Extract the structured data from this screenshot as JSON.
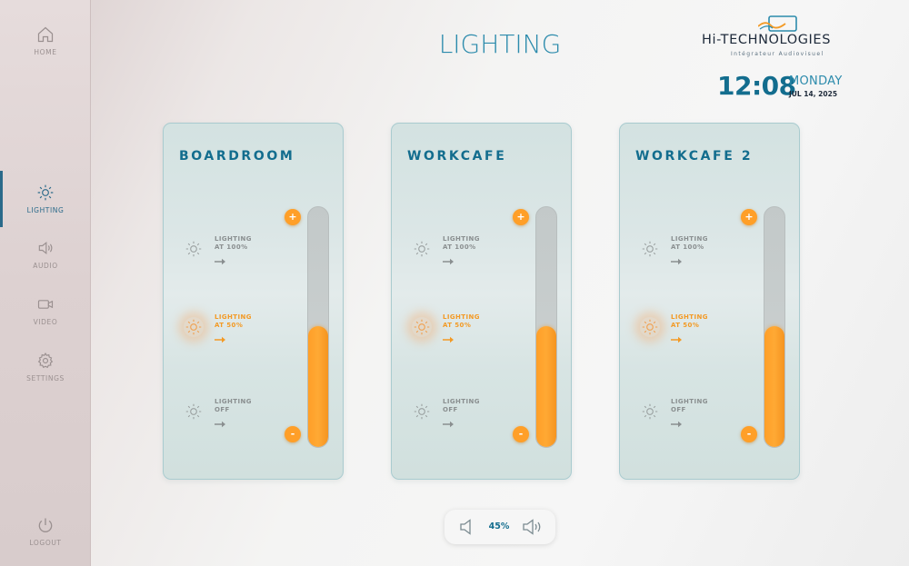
{
  "nav": {
    "items": [
      {
        "label": "HOME",
        "icon": "home-icon"
      },
      {
        "label": "LIGHTING",
        "icon": "sun-icon",
        "active": true
      },
      {
        "label": "AUDIO",
        "icon": "speaker-icon"
      },
      {
        "label": "VIDEO",
        "icon": "camera-icon"
      },
      {
        "label": "SETTINGS",
        "icon": "gear-icon"
      }
    ],
    "logout_label": "LOGOUT"
  },
  "header": {
    "title": "LIGHTING",
    "brand": "Hi-TECHNOLOGIES",
    "brand_sub": "Intégrateur Audiovisuel",
    "time": "12:08",
    "day": "MONDAY",
    "date": "JUL 14, 2025"
  },
  "rooms": [
    {
      "name": "BOARDROOM",
      "presets": [
        {
          "line1": "LIGHTING",
          "line2": "AT 100%"
        },
        {
          "line1": "LIGHTING",
          "line2": "AT 50%"
        },
        {
          "line1": "LIGHTING",
          "line2": "OFF"
        }
      ],
      "active_preset": 1,
      "level_percent": 50
    },
    {
      "name": "WORKCAFE",
      "presets": [
        {
          "line1": "LIGHTING",
          "line2": "AT 100%"
        },
        {
          "line1": "LIGHTING",
          "line2": "AT 50%"
        },
        {
          "line1": "LIGHTING",
          "line2": "OFF"
        }
      ],
      "active_preset": 1,
      "level_percent": 50
    },
    {
      "name": "WORKCAFE 2",
      "presets": [
        {
          "line1": "LIGHTING",
          "line2": "AT 100%"
        },
        {
          "line1": "LIGHTING",
          "line2": "AT 50%"
        },
        {
          "line1": "LIGHTING",
          "line2": "OFF"
        }
      ],
      "active_preset": 1,
      "level_percent": 50
    }
  ],
  "slider": {
    "plus_label": "+",
    "minus_label": "-"
  },
  "volume": {
    "value": "45%"
  },
  "colors": {
    "accent_blue": "#136d8e",
    "accent_orange": "#ff9f28",
    "muted_text": "#8a8f90"
  }
}
